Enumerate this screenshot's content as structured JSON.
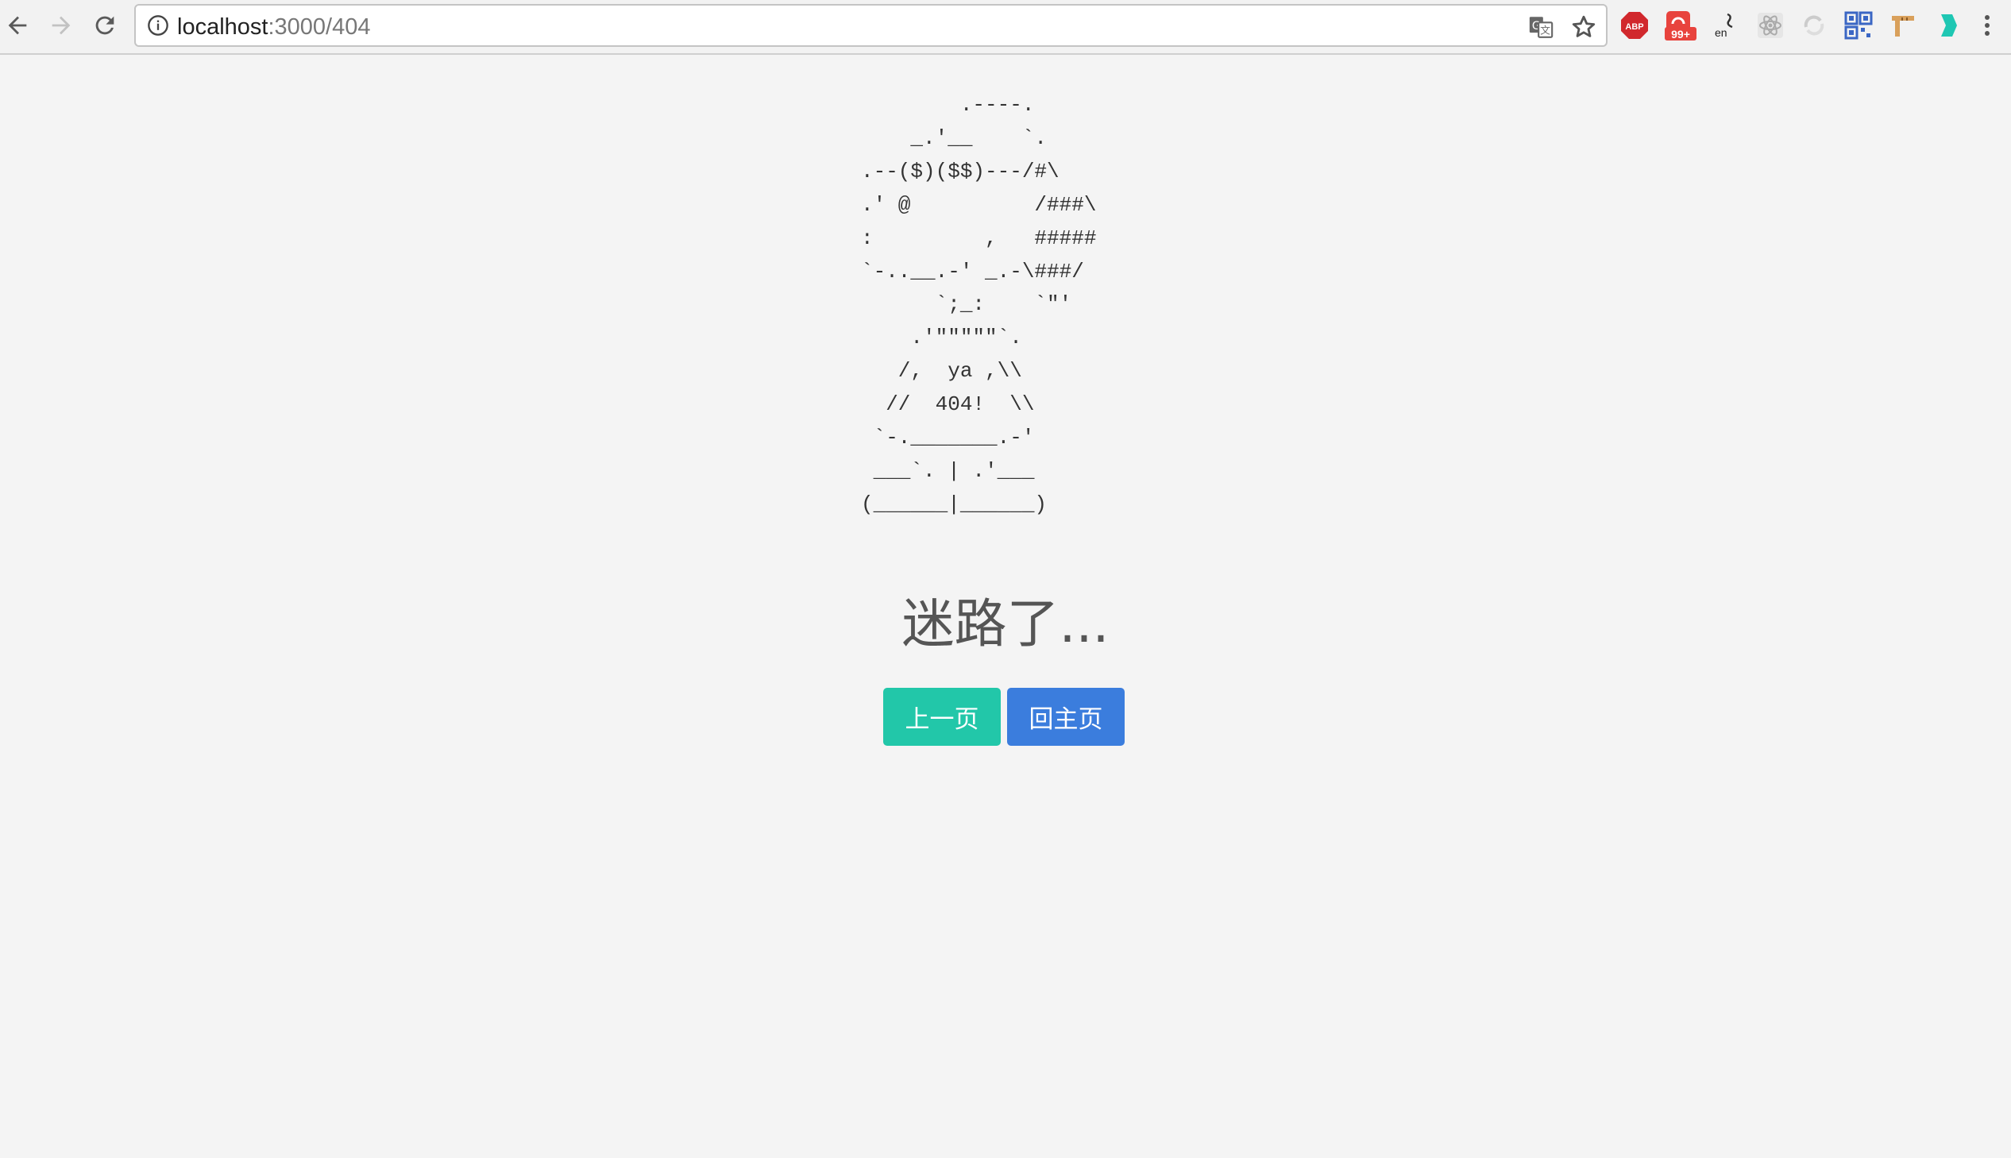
{
  "browser": {
    "url_host": "localhost",
    "url_path": ":3000/404",
    "extensions": {
      "abp_label": "ABP",
      "badge_count": "99+",
      "translate_label": "en"
    }
  },
  "page": {
    "ascii_art": "        .----.\n    _.'__    `.\n.--($)($$)---/#\\\n.' @          /###\\\n:         ,   #####\n`-..__.-' _.-\\###/\n      `;_:    `\"'\n    .'\"\"\"\"\"`.\n   /,  ya ,\\\\\n  //  404!  \\\\\n `-._______.-'\n ___`. | .'___\n(______|______)",
    "title": "迷路了...",
    "buttons": {
      "prev_label": "上一页",
      "home_label": "回主页"
    }
  },
  "colors": {
    "background": "#f4f4f4",
    "prev_button": "#22c7a9",
    "home_button": "#3b7ddd"
  }
}
